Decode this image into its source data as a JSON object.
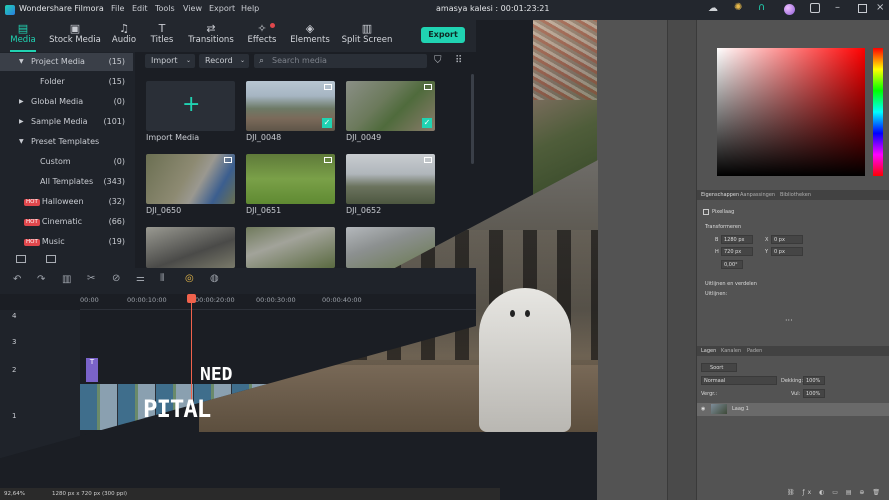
{
  "app": {
    "name": "Wondershare Filmora",
    "project_title": "amasya kalesi : 00:01:23:21"
  },
  "menu": [
    "File",
    "Edit",
    "Tools",
    "View",
    "Export",
    "Help"
  ],
  "tabs": [
    {
      "label": "Media",
      "icon": "media-icon",
      "active": true
    },
    {
      "label": "Stock Media",
      "icon": "stock-media-icon"
    },
    {
      "label": "Audio",
      "icon": "music-note-icon"
    },
    {
      "label": "Titles",
      "icon": "titles-icon"
    },
    {
      "label": "Transitions",
      "icon": "transitions-icon"
    },
    {
      "label": "Effects",
      "icon": "effects-icon"
    },
    {
      "label": "Elements",
      "icon": "elements-icon"
    },
    {
      "label": "Split Screen",
      "icon": "split-screen-icon"
    }
  ],
  "export_label": "Export",
  "sidebar": {
    "items": [
      {
        "label": "Project Media",
        "count": "(15)"
      },
      {
        "label": "Folder",
        "count": "(15)"
      },
      {
        "label": "Global Media",
        "count": "(0)"
      },
      {
        "label": "Sample Media",
        "count": "(101)"
      },
      {
        "label": "Preset Templates",
        "count": ""
      },
      {
        "label": "Custom",
        "count": "(0)"
      },
      {
        "label": "All Templates",
        "count": "(343)"
      },
      {
        "label": "Halloween",
        "count": "(32)",
        "hot": "HOT"
      },
      {
        "label": "Cinematic",
        "count": "(66)",
        "hot": "HOT"
      },
      {
        "label": "Music",
        "count": "(19)",
        "hot": "HOT"
      }
    ]
  },
  "media_toolbar": {
    "import": "Import",
    "record": "Record",
    "search_placeholder": "Search media"
  },
  "media_items": [
    {
      "label": "Import Media"
    },
    {
      "label": "DJI_0048"
    },
    {
      "label": "DJI_0049"
    },
    {
      "label": "DJI_0650"
    },
    {
      "label": "DJI_0651"
    },
    {
      "label": "DJI_0652"
    }
  ],
  "timeline": {
    "ruler": [
      "00:00",
      "00:00:10:00",
      "00:00:20:00",
      "00:00:30:00",
      "00:00:40:00"
    ],
    "tracks": [
      "4",
      "3",
      "2",
      "1"
    ],
    "audio_track": "1",
    "clip_text": "PITAL",
    "clip_text_top": "NED"
  },
  "photoshop": {
    "panel_tabs": [
      "Eigenschappen",
      "Aanpassingen",
      "Bibliotheken"
    ],
    "pixellaag": "Pixellaag",
    "transform_header": "Transformeren",
    "w_label": "B",
    "w_value": "1280 px",
    "h_label": "H",
    "h_value": "720 px",
    "x_label": "X",
    "x_value": "0 px",
    "y_label": "Y",
    "y_value": "0 px",
    "angle_value": "0,00°",
    "align_header": "Uitlijnen en verdelen",
    "align_sub": "Uitlijnen:",
    "layers_tabs": [
      "Lagen",
      "Kanalen",
      "Paden"
    ],
    "kind_label": "Soort",
    "blend_mode": "Normaal",
    "opacity_label": "Dekking:",
    "opacity_value": "100%",
    "lock_label": "Vergr.:",
    "fill_label": "Vul:",
    "fill_value": "100%",
    "layer_name": "Laag 1",
    "zoom": "92,64%",
    "doc_info": "1280 px x 720 px (300 ppi)"
  },
  "colors": {
    "accent": "#20d3b2",
    "playhead": "#f0624c",
    "hot": "#e0474c"
  }
}
